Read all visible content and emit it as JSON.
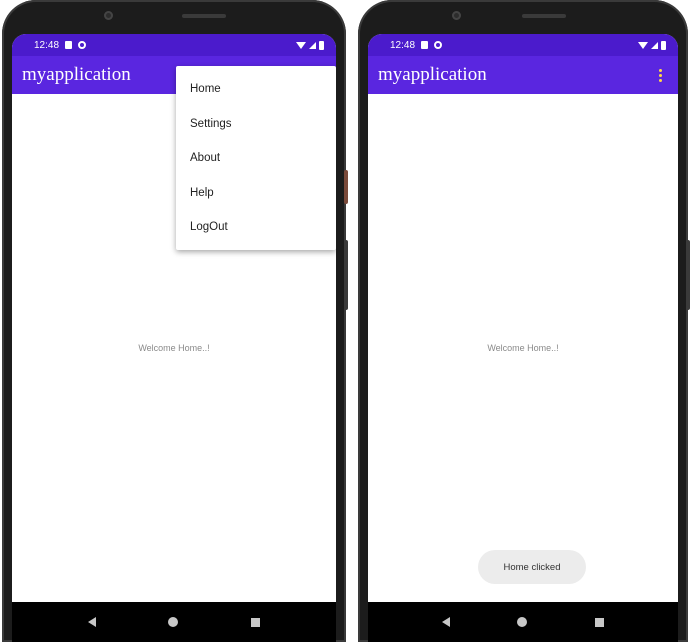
{
  "colors": {
    "status_bar": "#4b1bcc",
    "app_bar": "#5a26e0",
    "overflow_dots": "#ffd84a"
  },
  "left": {
    "status": {
      "time": "12:48"
    },
    "app_title": "myapplication",
    "menu": {
      "items": [
        {
          "label": "Home"
        },
        {
          "label": "Settings"
        },
        {
          "label": "About"
        },
        {
          "label": "Help"
        },
        {
          "label": "LogOut"
        }
      ]
    },
    "welcome_text": "Welcome Home..!"
  },
  "right": {
    "status": {
      "time": "12:48"
    },
    "app_title": "myapplication",
    "welcome_text": "Welcome Home..!",
    "toast": "Home clicked"
  },
  "icons": [
    "sim-icon",
    "circle-icon",
    "wifi-icon",
    "signal-icon",
    "battery-icon",
    "overflow-menu-icon",
    "nav-back-icon",
    "nav-home-icon",
    "nav-recents-icon"
  ]
}
